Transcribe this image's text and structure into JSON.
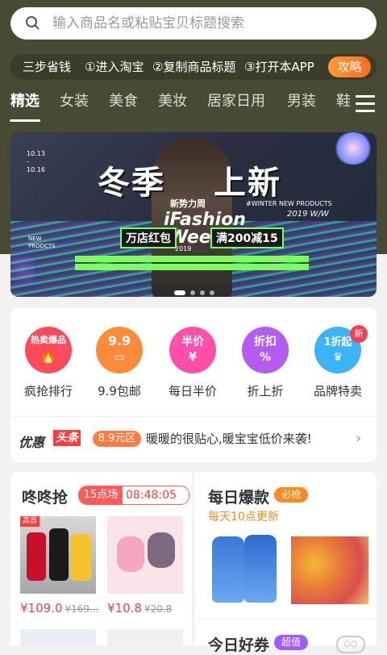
{
  "search": {
    "placeholder": "输入商品名或粘贴宝贝标题搜索"
  },
  "steps": {
    "title": "三步省钱",
    "step1": "①进入淘宝",
    "step2": "②复制商品标题",
    "step3": "③打开本APP",
    "button": "攻略"
  },
  "tabs": [
    "精选",
    "女装",
    "美食",
    "美妆",
    "居家日用",
    "男装",
    "鞋"
  ],
  "banner": {
    "date_top": "10.13",
    "date_bottom": "10.16",
    "title_left": "冬季",
    "title_right": "上新",
    "trend": "新势力周",
    "fashion1": "iFashion",
    "fashion2": "Week",
    "year_small": "2019",
    "sub": "#WINTER NEW PRODUCTS",
    "year": "2019 W/W",
    "promo_left": "万店红包",
    "promo_right": "满200减15",
    "new_products": "NEW PRODCTS"
  },
  "categories": [
    {
      "icon_text": "热卖爆品",
      "label": "疯抢排行",
      "color": "#ff4a5c"
    },
    {
      "icon_text": "9.9",
      "label": "9.9包邮",
      "color": "#ff8a3a"
    },
    {
      "icon_text": "半价",
      "label": "每日半价",
      "color": "#ff4fa8"
    },
    {
      "icon_text": "折扣",
      "label": "折上折",
      "color": "#b45cf0"
    },
    {
      "icon_text": "1折起",
      "label": "品牌特卖",
      "color": "#3ab4f2"
    }
  ],
  "new_badge": "新",
  "promo": {
    "title1": "优惠",
    "title2": "头条",
    "tag": "8.9元区",
    "text": "暖暖的很贴心,暖宝宝低价来袭!"
  },
  "flash": {
    "title": "咚咚抢",
    "session": "15点场",
    "countdown": "08:48:05",
    "hot_tag": "高首",
    "items": [
      {
        "price": "¥109.0",
        "old_price": "¥169..."
      },
      {
        "price": "¥10.8",
        "old_price": "¥20.8"
      }
    ]
  },
  "daily": {
    "title": "每日爆款",
    "badge": "必抢",
    "subtitle": "每天10点更新",
    "title2": "今日好券",
    "badge2": "超值",
    "go": "GO"
  }
}
